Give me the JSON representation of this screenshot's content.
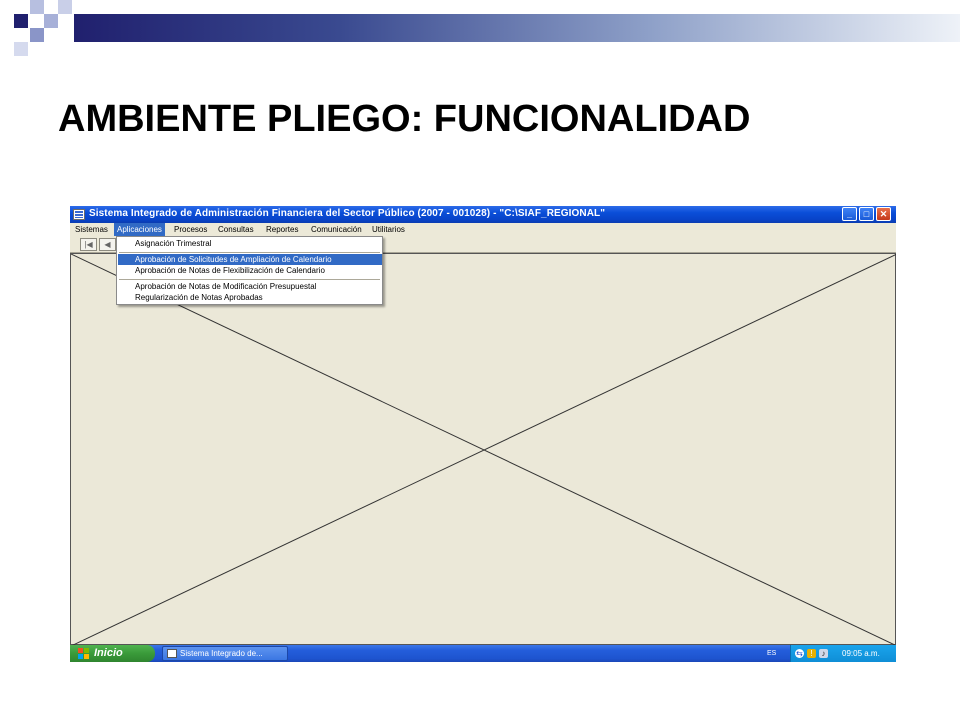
{
  "slide": {
    "title": "AMBIENTE PLIEGO: FUNCIONALIDAD"
  },
  "window": {
    "title": "Sistema Integrado de Administración Financiera del Sector Público (2007 - 001028) - \"C:\\SIAF_REGIONAL\"",
    "controls": {
      "minimize": "_",
      "maximize": "□",
      "close": "✕"
    }
  },
  "menubar": {
    "items": [
      "Sistemas",
      "Aplicaciones",
      "Procesos",
      "Consultas",
      "Reportes",
      "Comunicación",
      "Utilitarios"
    ],
    "active": "Aplicaciones"
  },
  "toolbar": {
    "first": "|◀",
    "prev": "◀"
  },
  "dropdown": {
    "items": [
      "Asignación Trimestral",
      "Aprobación de Solicitudes de Ampliación de Calendario",
      "Aprobación de Notas de Flexibilización de Calendario",
      "Aprobación de Notas de Modificación Presupuestal",
      "Regularización de Notas Aprobadas"
    ],
    "highlighted": "Aprobación de Solicitudes de Ampliación de Calendario"
  },
  "taskbar": {
    "start_label": "Inicio",
    "task_label": "Sistema Integrado de...",
    "language": "ES",
    "clock": "09:05 a.m."
  },
  "colors": {
    "titlebar": "#0a4ed8",
    "menu_highlight": "#316ac5",
    "workspace": "#ebe8d8",
    "slide_bar_dark": "#20206e"
  },
  "icons": {
    "tray": [
      "network-icon",
      "security-shield-icon",
      "volume-icon"
    ]
  }
}
